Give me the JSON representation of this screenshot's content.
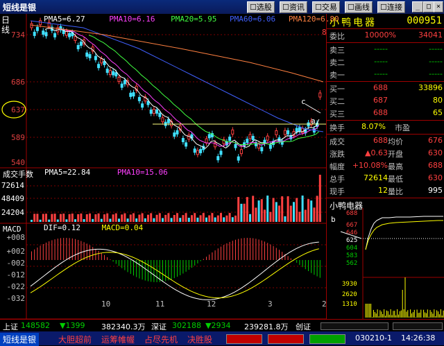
{
  "window": {
    "title": "短线是银",
    "buttons": [
      "选股",
      "资讯",
      "交易",
      "画线",
      "连接"
    ]
  },
  "main_chart": {
    "label": "日线",
    "ma_legend": [
      {
        "label": "PMA5=6.27",
        "color": "#ffffff"
      },
      {
        "label": "PMA10=6.16",
        "color": "#ff40ff"
      },
      {
        "label": "PMA20=5.95",
        "color": "#40ff40"
      },
      {
        "label": "PMA60=6.06",
        "color": "#4060ff"
      },
      {
        "label": "PMA120=6.80",
        "color": "#ff8040"
      }
    ],
    "price_axis": [
      "734",
      "686",
      "637",
      "589",
      "540"
    ],
    "annotations": [
      "c",
      "a"
    ],
    "partial_prefix": "8"
  },
  "volume_chart": {
    "label": "成交手数",
    "ma_legend": [
      {
        "label": "PMA5=22.84",
        "color": "#ffffff"
      },
      {
        "label": "PMA10=15.06",
        "color": "#ff40ff"
      }
    ],
    "axis": [
      "72614",
      "48409",
      "24204"
    ]
  },
  "macd_chart": {
    "label": "MACD",
    "legend": [
      {
        "label": "DIF=0.12",
        "color": "#ffffff"
      },
      {
        "label": "MACD=0.04",
        "color": "#ffff00"
      }
    ],
    "axis": [
      "+008",
      "+002",
      "-002",
      "-012",
      "-022",
      "-032"
    ]
  },
  "time_axis": [
    "10",
    "11",
    "12",
    "3",
    "2"
  ],
  "quote_panel": {
    "name": "小鸭电器",
    "code": "000951",
    "weibi_label": "委比",
    "weibi_value": "10000%",
    "weibi_diff": "34041",
    "sell": [
      {
        "label": "卖三",
        "price": "-----",
        "vol": "-----"
      },
      {
        "label": "卖二",
        "price": "-----",
        "vol": "-----"
      },
      {
        "label": "卖一",
        "price": "-----",
        "vol": "-----"
      }
    ],
    "buy": [
      {
        "label": "买一",
        "price": "688",
        "vol": "33896"
      },
      {
        "label": "买二",
        "price": "687",
        "vol": "80"
      },
      {
        "label": "买三",
        "price": "688",
        "vol": "65"
      }
    ],
    "huanshou_label": "换手",
    "huanshou_value": "8.07%",
    "shiying_label": "市盈",
    "stats": [
      {
        "l1": "成交",
        "v1": "688",
        "l2": "均价",
        "v2": "676"
      },
      {
        "l1": "涨跌",
        "v1": "▲0.63",
        "l2": "开盘",
        "v2": "630"
      },
      {
        "l1": "幅度",
        "v1": "+10.08%",
        "l2": "最高",
        "v2": "688"
      },
      {
        "l1": "总手",
        "v1": "72614",
        "l2": "最低",
        "v2": "630"
      },
      {
        "l1": "现手",
        "v1": "12",
        "l2": "量比",
        "v2": "995"
      }
    ],
    "mini_title": "小鸭电器",
    "mini_price_axis": [
      "688",
      "667",
      "646",
      "625",
      "604",
      "583",
      "562"
    ],
    "mini_vol_axis": [
      "3930",
      "2620",
      "1310"
    ],
    "mini_annotation": "b"
  },
  "status_bar": {
    "sh_label": "上证",
    "sh_value": "148582",
    "sh_change": "▼1399",
    "sh_amount": "382340.3万",
    "sz_label": "深证",
    "sz_value": "302188",
    "sz_change": "▼2934",
    "sz_amount": "239281.8万",
    "next_label": "创证"
  },
  "bottom_bar": {
    "app_label": "短线是银",
    "slogans": [
      "大胆超前",
      "运筹帷幄",
      "占尽先机",
      "决胜股"
    ],
    "date": "030210-1",
    "time": "14:26:38"
  }
}
